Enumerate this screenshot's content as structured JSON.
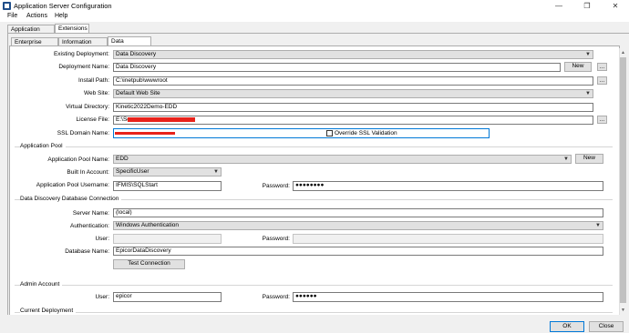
{
  "window": {
    "title": "Application Server Configuration",
    "icon": "app-window-icon",
    "minimize": "—",
    "maximize": "❐",
    "close": "✕"
  },
  "menubar": {
    "items": [
      "File",
      "Actions",
      "Help"
    ]
  },
  "top_tabs": [
    "Application Server",
    "Extensions"
  ],
  "sub_tabs": [
    "Enterprise Search",
    "Information Worker",
    "Data Discovery"
  ],
  "deployment": {
    "existing_label": "Existing Deployment:",
    "existing_value": "Data Discovery",
    "name_label": "Deployment Name:",
    "name_value": "Data Discovery",
    "new_button": "New",
    "browse_button": "...",
    "install_path_label": "Install Path:",
    "install_path_value": "C:\\inetpub\\wwwroot",
    "web_site_label": "Web Site:",
    "web_site_value": "Default Web Site",
    "virtual_dir_label": "Virtual Directory:",
    "virtual_dir_value": "Kinetic2022Demo-EDD",
    "license_label": "License File:",
    "license_value": "E:\\Sc",
    "ssl_domain_label": "SSL Domain Name:",
    "override_ssl_label": "Override SSL Validation"
  },
  "app_pool": {
    "group_title": "Application Pool",
    "name_label": "Application Pool Name:",
    "name_value": "EDD",
    "new_button": "New",
    "account_label": "Built In Account:",
    "account_value": "SpecificUser",
    "username_label": "Application Pool Username:",
    "username_value": "IFMIS\\SQLStart",
    "password_label": "Password:",
    "password_value": "●●●●●●●●"
  },
  "db_connection": {
    "group_title": "Data Discovery Database Connection",
    "server_label": "Server Name:",
    "server_value": "(local)",
    "auth_label": "Authentication:",
    "auth_value": "Windows Authentication",
    "user_label": "User:",
    "password_label": "Password:",
    "db_name_label": "Database Name:",
    "db_name_value": "EpicorDataDiscovery",
    "test_button": "Test Connection"
  },
  "admin": {
    "group_title": "Admin Account",
    "user_label": "User:",
    "user_value": "epicor",
    "password_label": "Password:",
    "password_value": "●●●●●●"
  },
  "current_deployment": {
    "group_title": "Current Deployment"
  },
  "footer": {
    "ok_button": "OK",
    "cancel_button": "Close"
  }
}
